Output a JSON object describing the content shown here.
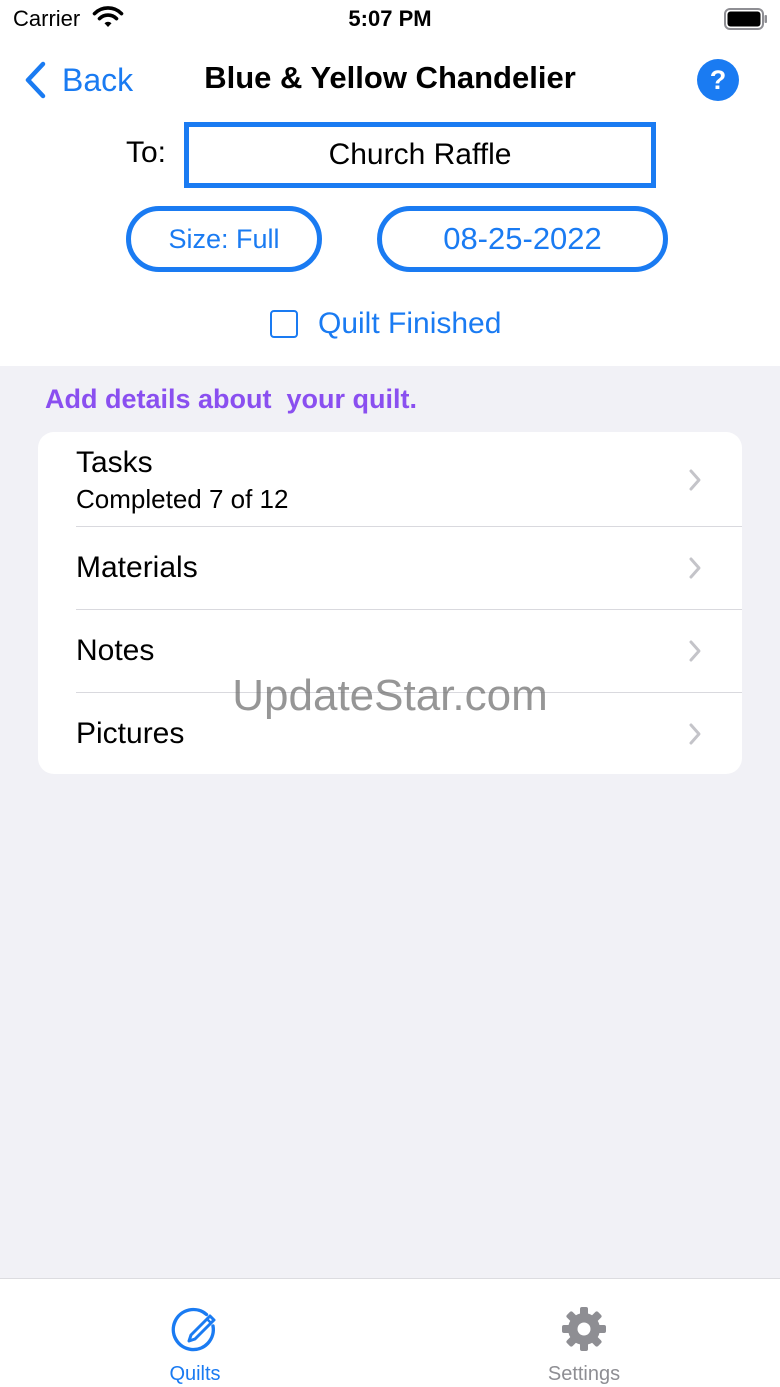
{
  "status_bar": {
    "carrier": "Carrier",
    "time": "5:07 PM"
  },
  "nav": {
    "back_label": "Back",
    "title": "Blue & Yellow Chandelier",
    "help_label": "?"
  },
  "form": {
    "to_label": "To:",
    "to_value": "Church Raffle",
    "size_label": "Size: Full",
    "date_label": "08-25-2022",
    "finished_label": "Quilt Finished",
    "finished_checked": false
  },
  "section": {
    "header": "Add details about  your quilt."
  },
  "list": {
    "items": [
      {
        "title": "Tasks",
        "subtitle": "Completed 7 of 12"
      },
      {
        "title": "Materials"
      },
      {
        "title": "Notes"
      },
      {
        "title": "Pictures"
      }
    ]
  },
  "watermark": "UpdateStar.com",
  "tabs": [
    {
      "label": "Quilts",
      "icon": "quilt-edit-icon",
      "active": true
    },
    {
      "label": "Settings",
      "icon": "gear-icon",
      "active": false
    }
  ],
  "colors": {
    "accent": "#1a7bf2",
    "section_header": "#8a4ff0",
    "inactive_tab": "#8e8e93",
    "background": "#f1f1f6"
  }
}
